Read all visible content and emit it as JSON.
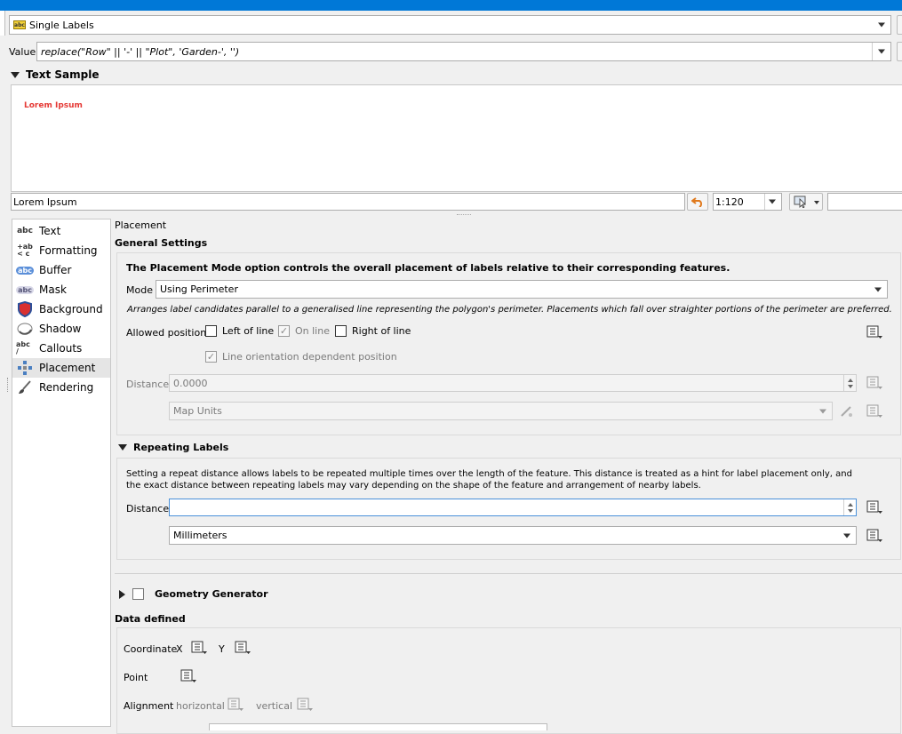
{
  "labels_mode": {
    "value": "Single Labels",
    "icon": "label-abc-icon"
  },
  "value_row": {
    "label": "Value",
    "expression": "replace(\"Row\" || '-' || \"Plot\", 'Garden-', '')"
  },
  "text_sample": {
    "title": "Text Sample",
    "preview_text": "Lorem Ipsum",
    "preview_color": "#e53935",
    "sample_input": "Lorem Ipsum",
    "scale": "1:120"
  },
  "sidebar": {
    "items": [
      {
        "label": "Text",
        "icon": "text-abc-icon"
      },
      {
        "label": "Formatting",
        "icon": "formatting-icon"
      },
      {
        "label": "Buffer",
        "icon": "buffer-icon"
      },
      {
        "label": "Mask",
        "icon": "mask-icon"
      },
      {
        "label": "Background",
        "icon": "background-shield-icon"
      },
      {
        "label": "Shadow",
        "icon": "shadow-icon"
      },
      {
        "label": "Callouts",
        "icon": "callouts-icon"
      },
      {
        "label": "Placement",
        "icon": "placement-icon",
        "selected": true
      },
      {
        "label": "Rendering",
        "icon": "rendering-brush-icon"
      }
    ]
  },
  "placement": {
    "header": "Placement",
    "general_title": "General Settings",
    "description": "The Placement Mode option controls the overall placement of labels relative to their corresponding features.",
    "mode_label": "Mode",
    "mode_value": "Using Perimeter",
    "mode_hint": "Arranges label candidates parallel to a generalised line representing the polygon's perimeter. Placements which fall over straighter portions of the perimeter are preferred.",
    "allowed_label": "Allowed positions",
    "left_of_line": "Left of line",
    "on_line": "On line",
    "right_of_line": "Right of line",
    "line_orientation": "Line orientation dependent position",
    "distance_label": "Distance",
    "distance_value": "0.0000",
    "distance_units": "Map Units"
  },
  "repeating": {
    "title": "Repeating Labels",
    "description": "Setting a repeat distance allows labels to be repeated multiple times over the length of the feature. This distance is treated as a hint for label placement only, and the exact distance between repeating labels may vary depending on the shape of the feature and arrangement of nearby labels.",
    "distance_label": "Distance",
    "distance_value": "",
    "units": "Millimeters"
  },
  "geometry_generator": {
    "title": "Geometry Generator"
  },
  "data_defined": {
    "title": "Data defined",
    "coordinate_label": "Coordinate",
    "x_label": "X",
    "y_label": "Y",
    "point_label": "Point",
    "alignment_label": "Alignment",
    "horizontal_label": "horizontal",
    "vertical_label": "vertical"
  },
  "colors": {
    "accent": "#0078d7",
    "focus": "#4a90d9"
  }
}
